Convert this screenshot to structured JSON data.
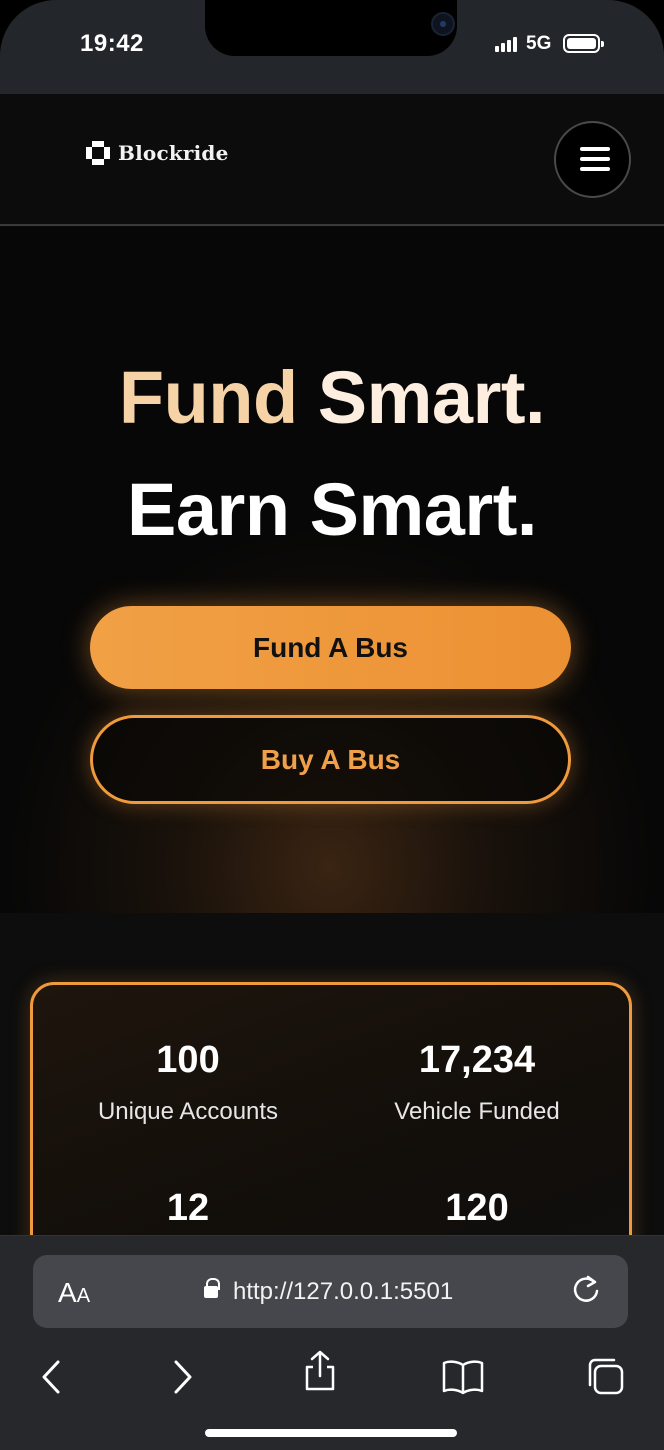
{
  "status": {
    "time": "19:42",
    "network": "5G"
  },
  "site": {
    "brand": "Blockride",
    "hero": {
      "headline_accent": "Fund",
      "headline_rest": "Smart.",
      "headline_line2": "Earn Smart.",
      "primary_cta": "Fund A Bus",
      "secondary_cta": "Buy A Bus"
    },
    "stats": [
      {
        "value": "100",
        "label": "Unique Accounts"
      },
      {
        "value": "17,234",
        "label": "Vehicle Funded"
      },
      {
        "value": "12",
        "label": ""
      },
      {
        "value": "120",
        "label": ""
      }
    ]
  },
  "browser": {
    "text_size_label_big": "A",
    "text_size_label_small": "A",
    "url": "http://127.0.0.1:5501"
  },
  "colors": {
    "accent": "#EF9A3D",
    "headline_accent": "#F6D3A6",
    "background": "#0A0A0A"
  }
}
